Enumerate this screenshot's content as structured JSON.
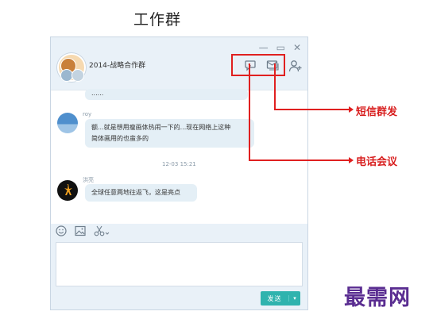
{
  "page_title": "工作群",
  "window": {
    "controls": {
      "minimize": "—",
      "maximize": "▭",
      "close": "✕"
    },
    "group_name": "2014-战略合作群"
  },
  "messages": [
    {
      "text": "......"
    },
    {
      "sender": "roy",
      "text_line1": "额...就是想用瘦画体热闹一下的...现在网络上这种",
      "text_line2": "简体画用的也蛮多的"
    },
    {
      "timestamp": "12-03 15:21"
    },
    {
      "sender": "洪亮",
      "text": "全球任意两地往返飞，这是亮点"
    }
  ],
  "send_button": {
    "label": "发送",
    "dropdown": "▾"
  },
  "annotations": {
    "sms": "短信群发",
    "conference": "电话会议"
  },
  "watermark": "最需网",
  "colors": {
    "accent": "#2fb3ae",
    "annotation": "#e02020",
    "watermark": "#5a2d91"
  }
}
